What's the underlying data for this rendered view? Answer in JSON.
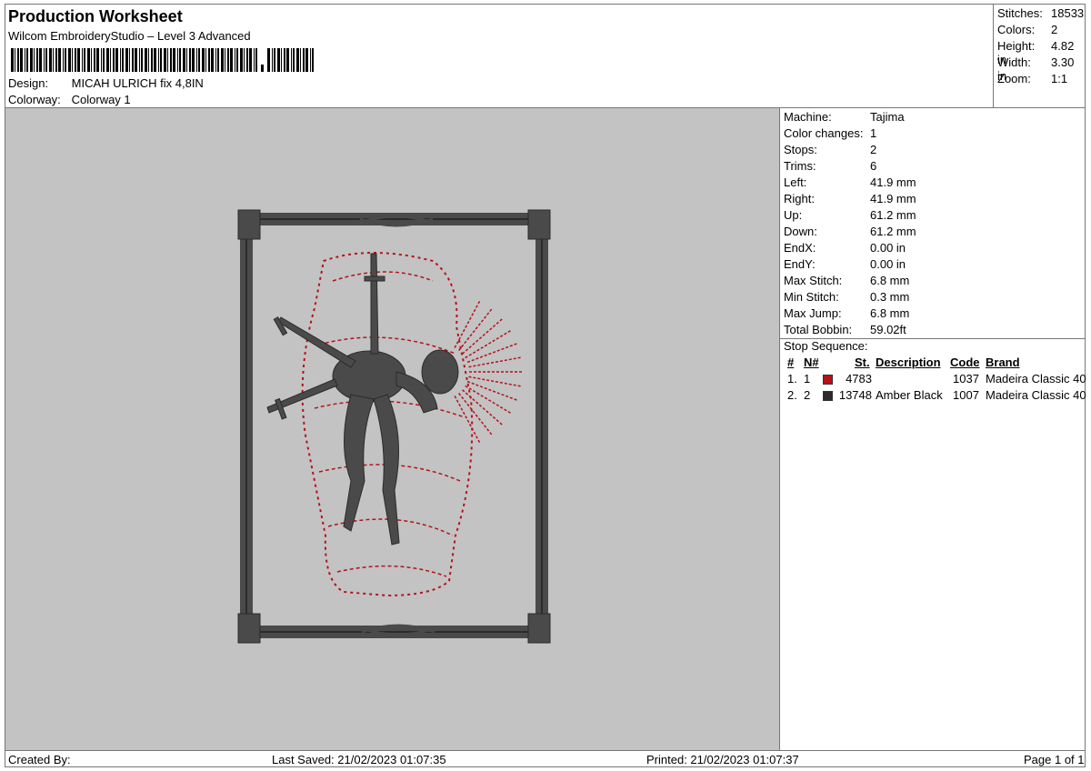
{
  "header": {
    "title": "Production Worksheet",
    "subtitle": "Wilcom EmbroideryStudio – Level 3 Advanced",
    "design_label": "Design:",
    "design_value": "MICAH ULRICH fix 4,8IN",
    "colorway_label": "Colorway:",
    "colorway_value": "Colorway 1"
  },
  "summary": [
    {
      "label": "Stitches:",
      "value": "18533"
    },
    {
      "label": "Colors:",
      "value": "2"
    },
    {
      "label": "Height:",
      "value": "4.82 in"
    },
    {
      "label": "Width:",
      "value": "3.30 in"
    },
    {
      "label": "Zoom:",
      "value": "1:1"
    }
  ],
  "machine_info": [
    {
      "label": "Machine:",
      "value": "Tajima"
    },
    {
      "label": "Color changes:",
      "value": "1"
    },
    {
      "label": "Stops:",
      "value": "2"
    },
    {
      "label": "Trims:",
      "value": "6"
    },
    {
      "label": "Left:",
      "value": "41.9 mm"
    },
    {
      "label": "Right:",
      "value": "41.9 mm"
    },
    {
      "label": "Up:",
      "value": "61.2 mm"
    },
    {
      "label": "Down:",
      "value": "61.2 mm"
    },
    {
      "label": "EndX:",
      "value": "0.00 in"
    },
    {
      "label": "EndY:",
      "value": "0.00 in"
    },
    {
      "label": "Max Stitch:",
      "value": "6.8 mm"
    },
    {
      "label": "Min Stitch:",
      "value": "0.3 mm"
    },
    {
      "label": "Max Jump:",
      "value": "6.8 mm"
    },
    {
      "label": "Total Bobbin:",
      "value": "59.02ft"
    }
  ],
  "stop_sequence": {
    "title": "Stop Sequence:",
    "headers": {
      "num": "#",
      "n": "N#",
      "st": "St.",
      "description": "Description",
      "code": "Code",
      "brand": "Brand"
    },
    "rows": [
      {
        "num": "1.",
        "n": "1",
        "color": "#b5121b",
        "st": "4783",
        "description": "",
        "code": "1037",
        "brand": "Madeira Classic 40"
      },
      {
        "num": "2.",
        "n": "2",
        "color": "#2b2b2b",
        "st": "13748",
        "description": "Amber Black",
        "code": "1007",
        "brand": "Madeira Classic 40"
      }
    ]
  },
  "footer": {
    "created_by": "Created By:",
    "last_saved": "Last Saved: 21/02/2023 01:07:35",
    "printed": "Printed: 21/02/2023 01:07:37",
    "page": "Page 1 of 1"
  },
  "colors": {
    "preview_bg": "#c3c3c3",
    "thread_black": "#4a4a4a",
    "thread_red": "#b5121b"
  }
}
